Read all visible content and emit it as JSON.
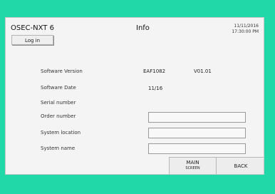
{
  "header": {
    "app_name": "OSEC-NXT 6",
    "title": "Info",
    "date": "11/11/2016",
    "time": "17:30:00 PM"
  },
  "login_button": {
    "label": "Log in"
  },
  "info": {
    "software_version_label": "Software Version",
    "software_version_code": "EAF1082",
    "software_version_number": "V01.01",
    "software_date_label": "Software Date",
    "software_date_value": "11/16",
    "serial_number_label": "Serial number",
    "order_number_label": "Order number",
    "order_number_value": "",
    "system_location_label": "System location",
    "system_location_value": "",
    "system_name_label": "System name",
    "system_name_value": ""
  },
  "footer": {
    "main_screen_line1": "MAIN",
    "main_screen_line2": "SCREEN",
    "back_label": "BACK"
  }
}
